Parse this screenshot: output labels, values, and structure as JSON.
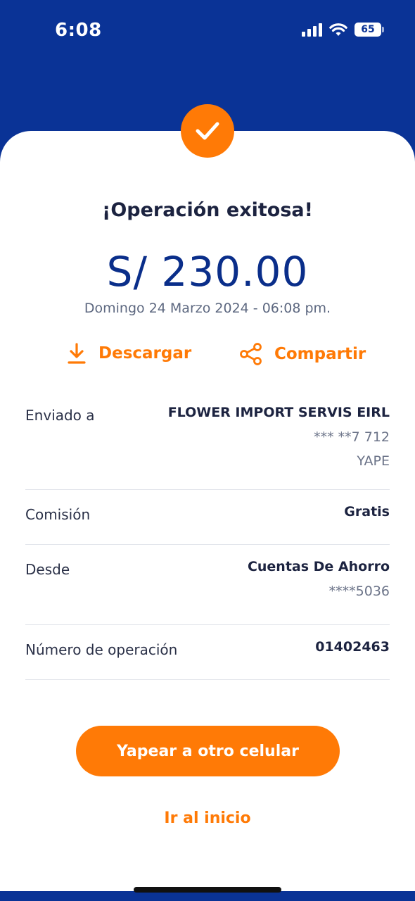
{
  "status_bar": {
    "time": "6:08",
    "battery": "65"
  },
  "receipt": {
    "title": "¡Operación exitosa!",
    "amount": "S/ 230.00",
    "date": "Domingo 24 Marzo 2024 - 06:08 pm."
  },
  "actions": {
    "download_label": "Descargar",
    "share_label": "Compartir"
  },
  "details": {
    "recipient": {
      "label": "Enviado a",
      "name": "FLOWER IMPORT SERVIS EIRL",
      "phone": "*** **7 712",
      "channel": "YAPE"
    },
    "commission": {
      "label": "Comisión",
      "value": "Gratis"
    },
    "from": {
      "label": "Desde",
      "account": "Cuentas De Ahorro",
      "number": "****5036"
    },
    "operation": {
      "label": "Número de operación",
      "value": "01402463"
    }
  },
  "buttons": {
    "primary": "Yapear a otro celular",
    "home": "Ir al inicio"
  },
  "colors": {
    "brand_blue": "#0a3396",
    "accent_orange": "#ff7a06"
  }
}
